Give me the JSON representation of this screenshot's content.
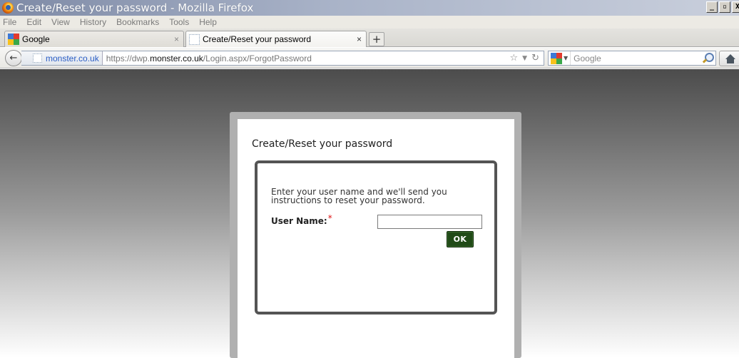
{
  "window": {
    "title": "Create/Reset your password - Mozilla Firefox",
    "controls": [
      "_",
      " ",
      "X"
    ]
  },
  "menu": [
    "File",
    "Edit",
    "View",
    "History",
    "Bookmarks",
    "Tools",
    "Help"
  ],
  "tabs": [
    {
      "label": "Google",
      "close": "×",
      "icon": "google-favicon"
    },
    {
      "label": "Create/Reset your password",
      "close": "×",
      "icon": "page-favicon"
    }
  ],
  "new_tab": "+",
  "nav": {
    "identity": "monster.co.uk",
    "url_prefix": "https://dwp.",
    "url_domain": "monster.co.uk",
    "url_path": "/Login.aspx/ForgotPassword",
    "search_placeholder": "Google"
  },
  "page": {
    "title": "Create/Reset your password",
    "instructions": "Enter your user name and we'll send you instructions to reset your password.",
    "username_label": "User Name:",
    "required_mark": "*",
    "username_value": "",
    "ok_label": "OK"
  },
  "colors": {
    "ok_button": "#204a17",
    "required": "#dd1111",
    "link": "#2a5dc5"
  }
}
